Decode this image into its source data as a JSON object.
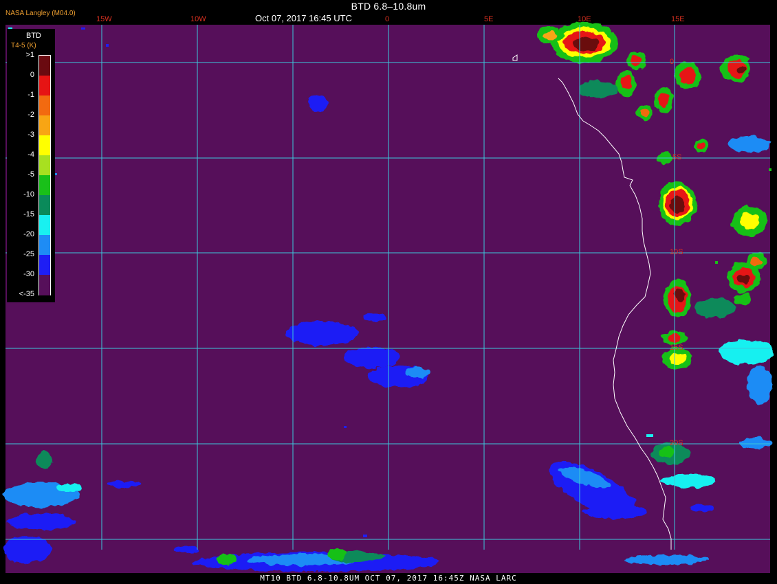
{
  "header": {
    "title": "BTD 6.8–10.8um",
    "datetime": "Oct 07, 2017 16:45 UTC",
    "credit": "NASA Langley (M04.0)"
  },
  "longitude_labels": [
    "15W",
    "10W",
    "0",
    "5E",
    "10E",
    "15E"
  ],
  "latitude_labels": [
    "0",
    "5S",
    "10S",
    "15S",
    "20S"
  ],
  "legend": {
    "title": "BTD",
    "subtitle": "T4-5 (K)",
    "entries": [
      {
        "label": ">1",
        "color": "#6a0a10"
      },
      {
        "label": "0",
        "color": "#e61414"
      },
      {
        "label": "-1",
        "color": "#f26a10"
      },
      {
        "label": "-2",
        "color": "#f8a514"
      },
      {
        "label": "-3",
        "color": "#ffff00"
      },
      {
        "label": "-4",
        "color": "#a8e020"
      },
      {
        "label": "-5",
        "color": "#19c019"
      },
      {
        "label": "-10",
        "color": "#0a8a5a"
      },
      {
        "label": "-15",
        "color": "#19f0f0"
      },
      {
        "label": "-20",
        "color": "#1e8cf5"
      },
      {
        "label": "-25",
        "color": "#1e1ef5"
      },
      {
        "label": "-30",
        "color": "#560f5a"
      },
      {
        "label": "<-35",
        "color": "#560f5a"
      }
    ]
  },
  "colors": {
    "background": "#560f5a",
    "grid": "#3cc8dc",
    "coastline": "#ffffff",
    "label": "#d83020"
  },
  "footer": {
    "text": "MT10  BTD 6.8-10.8UM   OCT 07, 2017 16:45Z   NASA LARC"
  }
}
